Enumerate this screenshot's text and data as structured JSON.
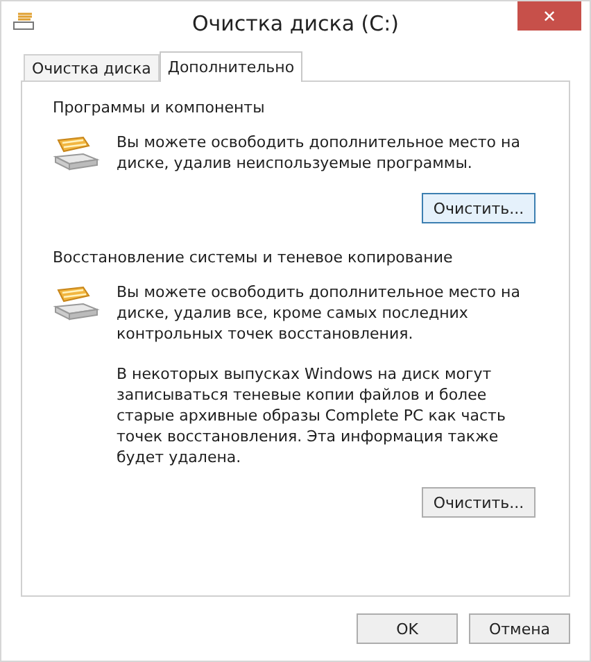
{
  "window": {
    "title": "Очистка диска  (C:)",
    "close": "✕"
  },
  "tabs": [
    {
      "label": "Очистка диска",
      "selected": false
    },
    {
      "label": "Дополнительно",
      "selected": true
    }
  ],
  "sections": [
    {
      "heading": "Программы и компоненты",
      "paragraphs": [
        "Вы можете освободить дополнительное место на диске, удалив неиспользуемые программы."
      ],
      "button": {
        "label": "Очистить...",
        "default": true
      }
    },
    {
      "heading": "Восстановление системы и теневое копирование",
      "paragraphs": [
        "Вы можете освободить дополнительное место на диске, удалив все, кроме самых последних контрольных точек восстановления.",
        "В некоторых выпусках Windows на диск могут записываться теневые копии файлов и более старые архивные образы Complete PC как часть точек восстановления. Эта информация также будет удалена."
      ],
      "button": {
        "label": "Очистить...",
        "default": false
      }
    }
  ],
  "buttons": [
    "OK",
    "Отмена"
  ]
}
